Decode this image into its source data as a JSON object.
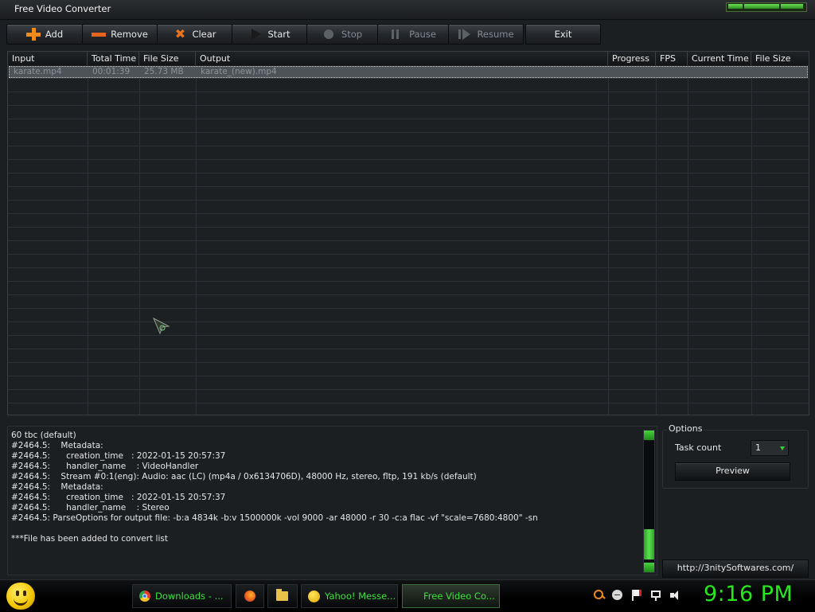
{
  "window": {
    "title": "Free Video Converter"
  },
  "toolbar": {
    "add": "Add",
    "remove": "Remove",
    "clear": "Clear",
    "start": "Start",
    "stop": "Stop",
    "pause": "Pause",
    "resume": "Resume",
    "exit": "Exit"
  },
  "grid": {
    "columns": [
      "Input",
      "Total Time",
      "File Size",
      "Output",
      "Progress",
      "FPS",
      "Current Time",
      "File Size"
    ],
    "rows": [
      {
        "input": "karate.mp4",
        "total_time": "00:01:39",
        "file_size": "25.73 MB",
        "output": "karate_(new).mp4",
        "progress": "",
        "fps": "",
        "current_time": "",
        "out_size": ""
      }
    ]
  },
  "log": {
    "lines": [
      "60 tbc (default)",
      "#2464.5:    Metadata:",
      "#2464.5:      creation_time   : 2022-01-15 20:57:37",
      "#2464.5:      handler_name    : VideoHandler",
      "#2464.5:    Stream #0:1(eng): Audio: aac (LC) (mp4a / 0x6134706D), 48000 Hz, stereo, fltp, 191 kb/s (default)",
      "#2464.5:    Metadata:",
      "#2464.5:      creation_time   : 2022-01-15 20:57:37",
      "#2464.5:      handler_name    : Stereo",
      "#2464.5: ParseOptions for output file: -b:a 4834k -b:v 1500000k -vol 9000 -ar 48000 -r 30 -c:a flac -vf \"scale=7680:4800\" -sn",
      "",
      "***File has been added to convert list"
    ]
  },
  "options": {
    "legend": "Options",
    "task_count_label": "Task count",
    "task_count_value": "1",
    "preview": "Preview"
  },
  "url": "http://3nitySoftwares.com/",
  "taskbar": {
    "items": [
      "Downloads - ...",
      "Yahoo! Messe...",
      "Free Video Co..."
    ],
    "clock": "9:16 PM"
  },
  "colors": {
    "accent": "#27e81f",
    "orange_icon": "#f08c1c"
  }
}
